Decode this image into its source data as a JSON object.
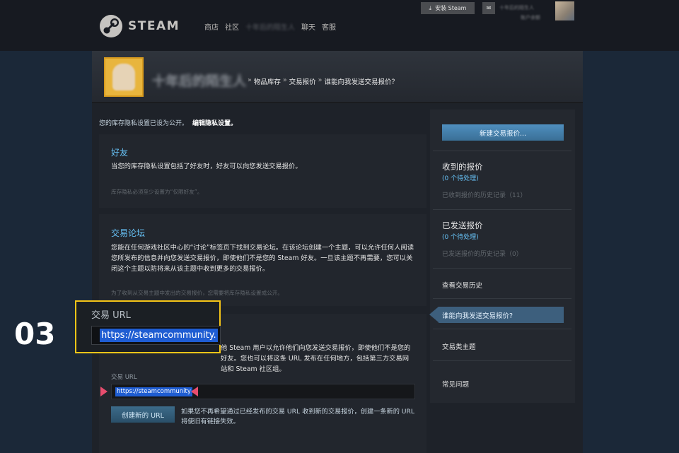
{
  "header": {
    "brand": "STEAM",
    "nav": [
      "商店",
      "社区",
      "十年后的陌生人",
      "聊天",
      "客服"
    ],
    "install_label": "安装 Steam",
    "account_name": "十年后的陌生人",
    "account_sub": "账户余额"
  },
  "profile": {
    "name": "十年后的陌生人",
    "breadcrumbs": [
      "物品库存",
      "交易报价",
      "谁能向我发送交易报价？"
    ]
  },
  "intro": {
    "text": "您的库存隐私设置已设为公开。",
    "link": "编辑隐私设置。"
  },
  "friends": {
    "title": "好友",
    "text": "当您的库存隐私设置包括了好友时，好友可以向您发送交易报价。",
    "note": "库存隐私必须至少设置为“仅限好友”。"
  },
  "forum": {
    "title": "交易论坛",
    "text": "您能在任何游戏社区中心的“讨论”标签页下找到交易论坛。在该论坛创建一个主题，可以允许任何人阅读您所发布的信息并向您发送交易报价，即使他们不是您的 Steam 好友。一旦该主题不再需要，您可以关闭这个主题以防将来从该主题中收到更多的交易报价。",
    "note": "为了收到从交易主题中发出的交易报价，您需要将库存隐私设置成公开。"
  },
  "url_section": {
    "text": "他 Steam 用户以允许他们向您发送交易报价，即使他们不是您的好友。您也可以将这条 URL 发布在任何地方，包括第三方交易网站和 Steam 社区组。",
    "label": "交易 URL",
    "url_value": "https://steamcommunity",
    "new_url_button": "创建新的 URL",
    "new_url_note": "如果您不再希望通过已经发布的交易 URL 收到新的交易报价，创建一条新的 URL 将使旧有链接失效。"
  },
  "callout": {
    "step": "03",
    "title": "交易 URL",
    "url_value": "https://steamcommunity."
  },
  "sidebar": {
    "new_offer": "新建交易报价...",
    "received_title": "收到的报价",
    "received_pending": "(0 个待处理)",
    "received_history": "已收到报价的历史记录（11）",
    "sent_title": "已发送报价",
    "sent_pending": "(0 个待处理)",
    "sent_history": "已发送报价的历史记录（0）",
    "trade_history": "查看交易历史",
    "who_can_send": "谁能向我发送交易报价?",
    "trading_topics": "交易类主题",
    "faq": "常见问题"
  },
  "colors": {
    "accent": "#66c0f4",
    "highlight": "#f5c518",
    "marker": "#e84d6e",
    "selection": "#1f5dd2"
  }
}
